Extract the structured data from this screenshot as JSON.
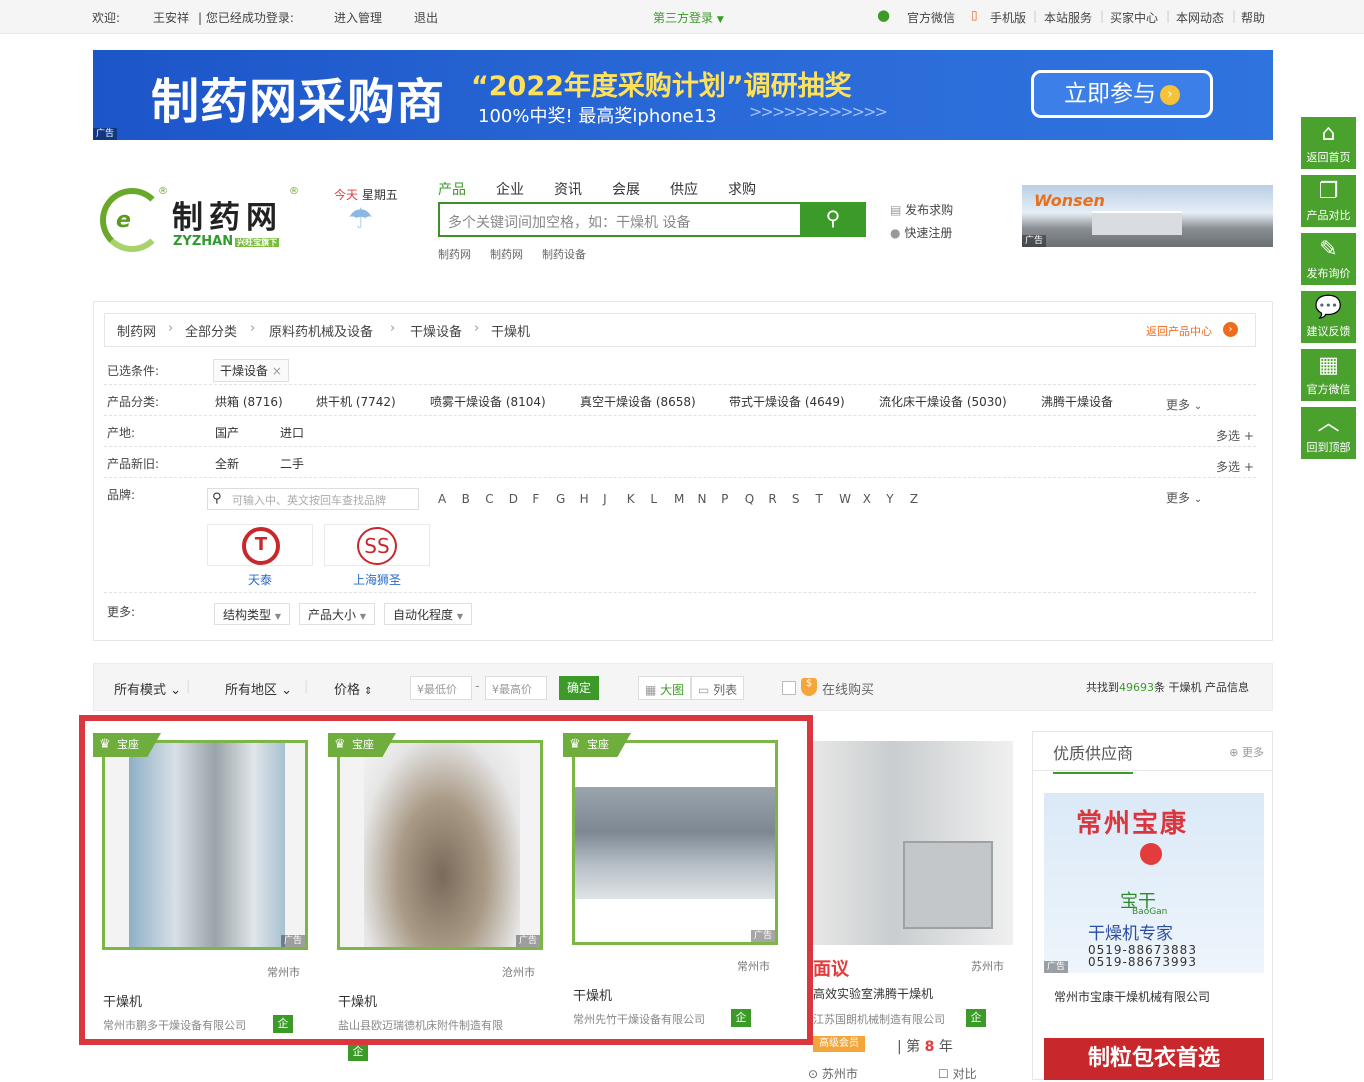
{
  "topbar": {
    "welcome": "欢迎:",
    "user": "王安祥",
    "login_status": "| 您已经成功登录:",
    "manage": "进入管理",
    "logout": "退出",
    "third_login": "第三方登录",
    "wechat": "官方微信",
    "mobile": "手机版",
    "service": "本站服务",
    "buyer": "买家中心",
    "news": "本网动态",
    "help": "帮助"
  },
  "banner": {
    "title": "制药网采购商",
    "slogan": "“2022年度采购计划”调研抽奖",
    "sub": "100%中奖! 最高奖iphone13",
    "arrows": ">>>>>>>>>>>>",
    "cta": "立即参与",
    "ad": "广告"
  },
  "logo": {
    "name": "制药网",
    "sub": "ZYZHAN",
    "tag": "兴旺宝旗下",
    "mark": "®"
  },
  "today": {
    "label": "今天",
    "weekday": "星期五"
  },
  "nav": {
    "tabs": [
      "产品",
      "企业",
      "资讯",
      "会展",
      "供应",
      "求购"
    ]
  },
  "search": {
    "placeholder": "多个关键词间加空格，如：干燥机 设备",
    "hot": [
      "制药网",
      "制药网",
      "制药设备"
    ]
  },
  "quick": {
    "post_buy": "发布求购",
    "register": "快速注册"
  },
  "side_ad": {
    "brand": "Wonsen",
    "ad": "广告"
  },
  "rail": [
    {
      "label": "返回首页",
      "icon": "home-icon"
    },
    {
      "label": "产品对比",
      "icon": "compare-icon"
    },
    {
      "label": "发布询价",
      "icon": "edit-icon"
    },
    {
      "label": "建议反馈",
      "icon": "chat-icon"
    },
    {
      "label": "官方微信",
      "icon": "qrcode-icon"
    },
    {
      "label": "回到顶部",
      "icon": "arrow-up-icon"
    }
  ],
  "breadcrumb": {
    "items": [
      "制药网",
      "全部分类",
      "原料药机械及设备",
      "干燥设备",
      "干燥机"
    ],
    "back": "返回产品中心"
  },
  "filters": {
    "selected_label": "已选条件:",
    "selected_tag": "干燥设备",
    "category_label": "产品分类:",
    "categories": [
      "烘箱 (8716)",
      "烘干机 (7742)",
      "喷雾干燥设备 (8104)",
      "真空干燥设备 (8658)",
      "带式干燥设备 (4649)",
      "流化床干燥设备 (5030)",
      "沸腾干燥设备"
    ],
    "more": "更多",
    "origin_label": "产地:",
    "origins": [
      "国产",
      "进口"
    ],
    "condition_label": "产品新旧:",
    "conditions": [
      "全新",
      "二手"
    ],
    "multi": "多选",
    "brand_label": "品牌:",
    "brand_placeholder": "可输入中、英文按回车查找品牌",
    "letters": [
      "A",
      "B",
      "C",
      "D",
      "F",
      "G",
      "H",
      "J",
      "K",
      "L",
      "M",
      "N",
      "P",
      "Q",
      "R",
      "S",
      "T",
      "W",
      "X",
      "Y",
      "Z"
    ],
    "brands": [
      "天泰",
      "上海狮圣"
    ],
    "more_label": "更多:",
    "dropdowns": [
      "结构类型",
      "产品大小",
      "自动化程度"
    ]
  },
  "sortbar": {
    "mode": "所有模式",
    "region": "所有地区",
    "price": "价格",
    "min": "¥最低价",
    "max": "¥最高价",
    "ok": "确定",
    "grid": "大图",
    "list": "列表",
    "online": "在线购买",
    "total_prefix": "共找到",
    "total": "49693",
    "total_suffix": "条 干燥机 产品信息"
  },
  "products": [
    {
      "badge": "宝座",
      "city": "常州市",
      "name": "干燥机",
      "company": "常州市鹏多干燥设备有限公司",
      "qi": "企"
    },
    {
      "badge": "宝座",
      "city": "沧州市",
      "name": "干燥机",
      "company": "盐山县欧迈瑞德机床附件制造有限",
      "qi": "企"
    },
    {
      "badge": "宝座",
      "city": "常州市",
      "name": "干燥机",
      "company": "常州先竹干燥设备有限公司",
      "qi": "企"
    }
  ],
  "product4": {
    "headline": "面议",
    "city": "苏州市",
    "name": "高效实验室沸腾干燥机",
    "company": "江苏国朗机械制造有限公司",
    "qi": "企",
    "member": "高级会员",
    "year_prefix": "| 第",
    "year": "8",
    "year_suffix": "年",
    "loc": "苏州市",
    "compare": "对比"
  },
  "suppliers": {
    "title": "优质供应商",
    "more": "更多",
    "ad_title": "常州宝康",
    "ad_logo": "宝干",
    "ad_brand": "BaoGan",
    "ad_sub": "干燥机专家",
    "phone1": "0519-88673883",
    "phone2": "0519-88673993",
    "company": "常州市宝康干燥机械有限公司",
    "banner2": "制粒包衣首选"
  },
  "ad_label": "广告",
  "colors": {
    "green": "#3b9a28",
    "blue": "#1c55c8",
    "red": "#d9363e"
  }
}
